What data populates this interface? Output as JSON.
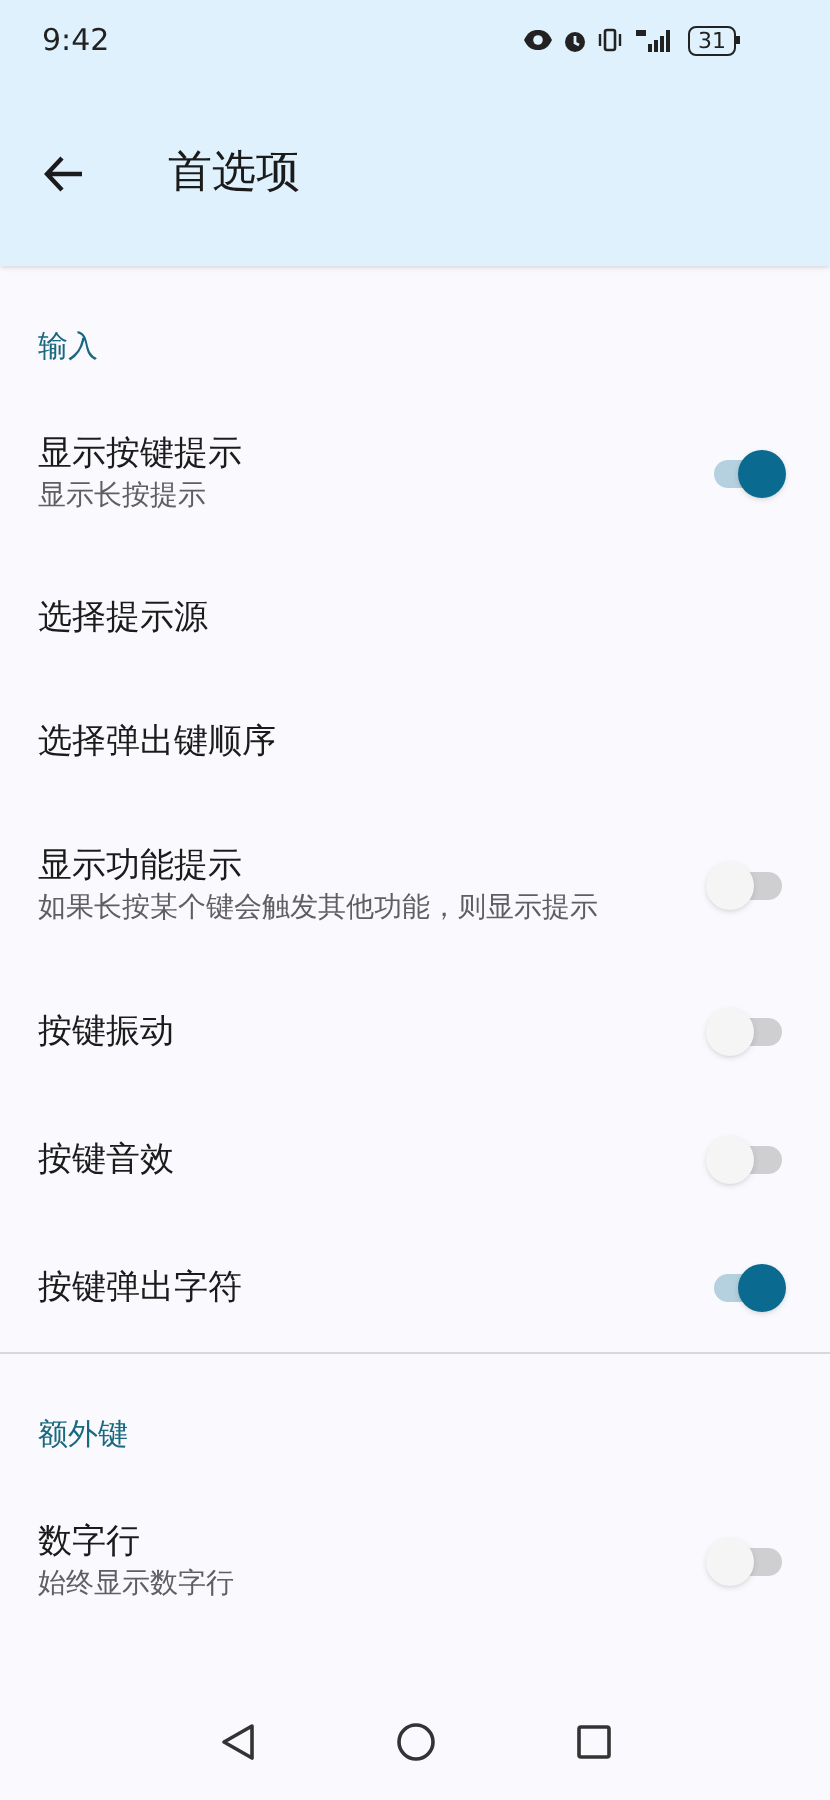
{
  "status_bar": {
    "time": "9:42",
    "battery": "31"
  },
  "app_bar": {
    "title": "首选项"
  },
  "sections": [
    {
      "title": "输入",
      "items": [
        {
          "kind": "toggle",
          "title": "显示按键提示",
          "summary": "显示长按提示",
          "on": true
        },
        {
          "kind": "plain",
          "title": "选择提示源"
        },
        {
          "kind": "plain",
          "title": "选择弹出键顺序"
        },
        {
          "kind": "toggle",
          "title": "显示功能提示",
          "summary": "如果长按某个键会触发其他功能，则显示提示",
          "on": false
        },
        {
          "kind": "toggle",
          "title": "按键振动",
          "on": false
        },
        {
          "kind": "toggle",
          "title": "按键音效",
          "on": false
        },
        {
          "kind": "toggle",
          "title": "按键弹出字符",
          "on": true
        }
      ]
    },
    {
      "title": "额外键",
      "items": [
        {
          "kind": "toggle",
          "title": "数字行",
          "summary": "始终显示数字行",
          "on": false
        }
      ]
    }
  ]
}
